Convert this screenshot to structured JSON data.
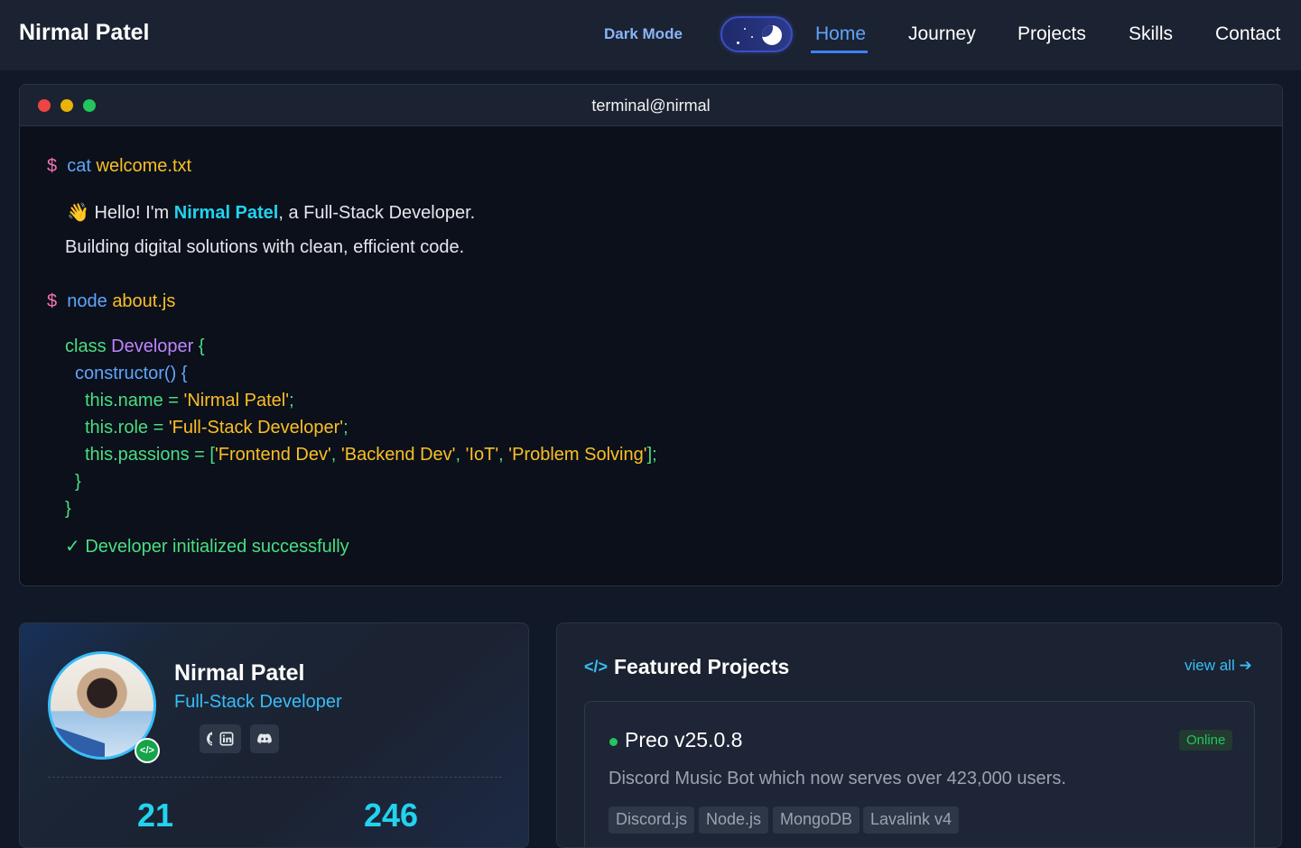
{
  "nav": {
    "brand": "Nirmal Patel",
    "dark_mode_label": "Dark Mode",
    "links": [
      "Home",
      "Journey",
      "Projects",
      "Skills",
      "Contact"
    ],
    "active": "Home"
  },
  "terminal": {
    "title": "terminal@nirmal",
    "prompt": "$",
    "cmd1": {
      "name": "cat",
      "arg": "welcome.txt"
    },
    "welcome": {
      "emoji": "👋",
      "hello_pre": "Hello! I'm ",
      "hello_name": "Nirmal Patel",
      "hello_post": ", a Full-Stack Developer.",
      "line2": "Building digital solutions with clean, efficient code."
    },
    "cmd2": {
      "name": "node",
      "arg": "about.js"
    },
    "code": {
      "class_kw": "class",
      "class_name": "Developer",
      "open_brace": "{",
      "constructor": "constructor() {",
      "name_prop": "this.name = ",
      "name_val": "'Nirmal Patel'",
      "role_prop": "this.role = ",
      "role_val": "'Full-Stack Developer'",
      "passions_prop": "this.passions = [",
      "passions": [
        "'Frontend Dev'",
        "'Backend Dev'",
        "'IoT'",
        "'Problem Solving'"
      ],
      "passions_end": "];",
      "close1": "}",
      "close2": "}"
    },
    "success": "✓ Developer initialized successfully"
  },
  "profile": {
    "name": "Nirmal Patel",
    "role": "Full-Stack Developer",
    "badge_icon": "code-icon",
    "socials": [
      "github-icon",
      "linkedin-icon",
      "discord-icon"
    ],
    "stats": [
      "21",
      "246"
    ]
  },
  "featured": {
    "icon": "</>",
    "title": "Featured Projects",
    "view_all": "view all",
    "project": {
      "name": "Preo v25.0.8",
      "status": "Online",
      "description": "Discord Music Bot which now serves over 423,000 users.",
      "tags": [
        "Discord.js",
        "Node.js",
        "MongoDB",
        "Lavalink v4"
      ]
    }
  }
}
